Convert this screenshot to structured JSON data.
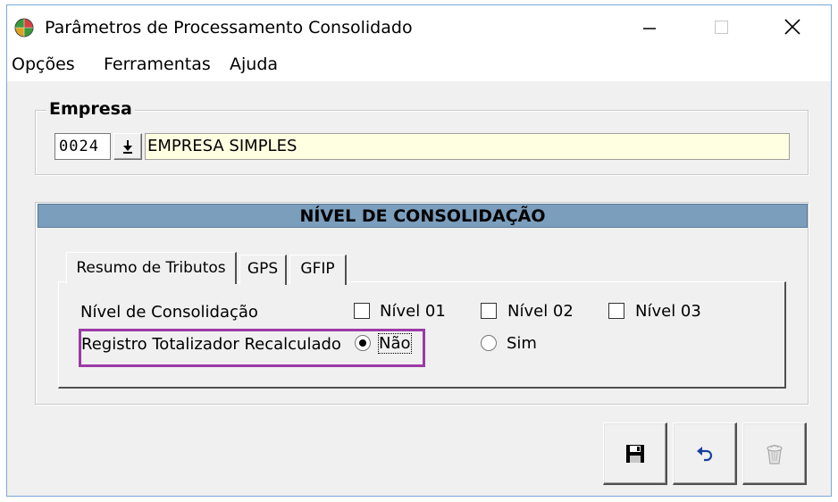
{
  "window": {
    "title": "Parâmetros de Processamento Consolidado"
  },
  "menu": {
    "items": [
      "Opções",
      "Ferramentas",
      "Ajuda"
    ]
  },
  "empresa": {
    "legend": "Empresa",
    "code": "0024",
    "name": "EMPRESA SIMPLES"
  },
  "consolidacao": {
    "header": "NÍVEL DE CONSOLIDAÇÃO",
    "tabs": [
      "Resumo de Tributos",
      "GPS",
      "GFIP"
    ],
    "active_tab": "Resumo de Tributos",
    "nivel_label": "Nível de Consolidação",
    "niveis": [
      {
        "label": "Nível 01",
        "checked": false
      },
      {
        "label": "Nível 02",
        "checked": false
      },
      {
        "label": "Nível 03",
        "checked": false
      }
    ],
    "registro_label": "Registro Totalizador Recalculado",
    "registro_options": [
      {
        "label": "Não",
        "selected": true
      },
      {
        "label": "Sim",
        "selected": false
      }
    ]
  },
  "colors": {
    "header_bg": "#7b9ebd",
    "name_field_bg": "#ffffe1",
    "highlight": "#9b3ba6"
  },
  "icons": [
    "app-globe-icon",
    "minimize-icon",
    "maximize-icon",
    "close-icon",
    "download-arrow-icon",
    "save-floppy-icon",
    "undo-icon",
    "delete-trash-icon"
  ]
}
